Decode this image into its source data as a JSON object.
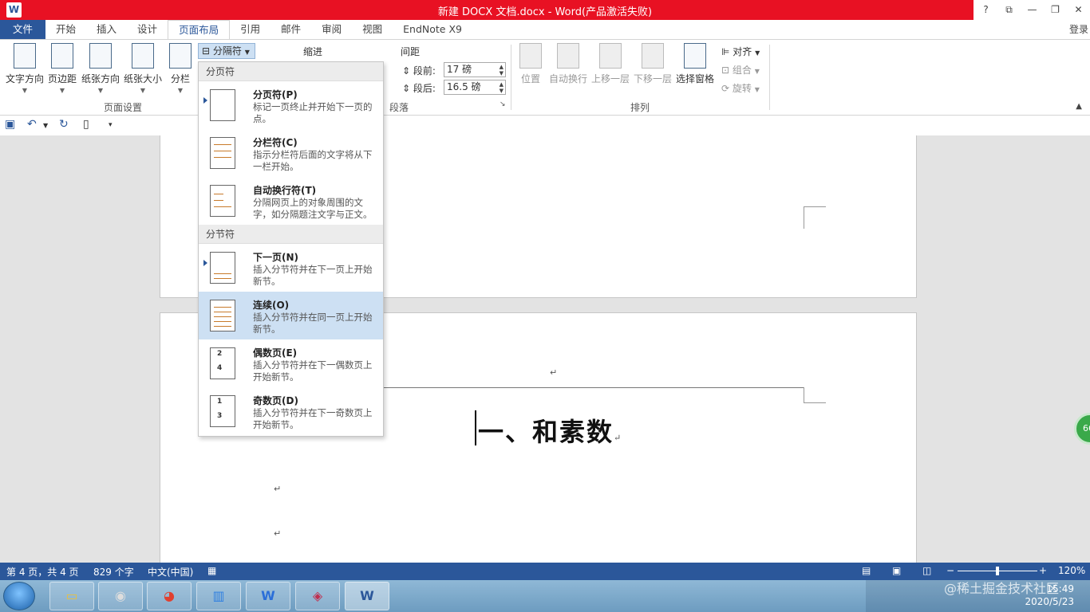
{
  "title": "新建 DOCX 文档.docx -  Word(产品激活失败)",
  "window_buttons": [
    "?",
    "⧉",
    "—",
    "❐",
    "✕"
  ],
  "tabs": [
    "文件",
    "开始",
    "插入",
    "设计",
    "页面布局",
    "引用",
    "邮件",
    "审阅",
    "视图",
    "EndNote X9"
  ],
  "login": "登录",
  "ribbon": {
    "page_setup": {
      "buttons": [
        "文字方向",
        "页边距",
        "纸张方向",
        "纸张大小",
        "分栏"
      ],
      "group_label": "页面设置",
      "breaks_button": "分隔符"
    },
    "paragraph": {
      "indent_label": "缩进",
      "spacing_label": "间距",
      "before_label": "段前:",
      "before_value": "17 磅",
      "after_label": "段后:",
      "after_value": "16.5 磅",
      "group_label": "段落"
    },
    "arrange": {
      "buttons": [
        "位置",
        "自动换行",
        "上移一层",
        "下移一层",
        "选择窗格"
      ],
      "small_buttons": [
        "对齐",
        "组合",
        "旋转"
      ],
      "group_label": "排列"
    }
  },
  "breaks_menu": {
    "page_breaks_header": "分页符",
    "page_breaks": [
      {
        "title": "分页符(P)",
        "desc": "标记一页终止并开始下一页的点。"
      },
      {
        "title": "分栏符(C)",
        "desc": "指示分栏符后面的文字将从下一栏开始。"
      },
      {
        "title": "自动换行符(T)",
        "desc": "分隔网页上的对象周围的文字，如分隔题注文字与正文。"
      }
    ],
    "section_breaks_header": "分节符",
    "section_breaks": [
      {
        "title": "下一页(N)",
        "desc": "插入分节符并在下一页上开始新节。"
      },
      {
        "title": "连续(O)",
        "desc": "插入分节符并在同一页上开始新节。"
      },
      {
        "title": "偶数页(E)",
        "desc": "插入分节符并在下一偶数页上开始新节。",
        "nums": [
          "2",
          "4"
        ]
      },
      {
        "title": "奇数页(D)",
        "desc": "插入分节符并在下一奇数页上开始新节。",
        "nums": [
          "1",
          "3"
        ]
      }
    ]
  },
  "document": {
    "heading": "一、和素数",
    "para_mark": "↵",
    "badge": "66"
  },
  "status": {
    "page": "第 4 页，共 4 页",
    "words": "829 个字",
    "lang": "中文(中国)",
    "zoom": "120%",
    "zoom_minus": "−",
    "zoom_plus": "+"
  },
  "taskbar": {
    "time": "15:49",
    "date": "2020/5/23",
    "watermark": "@稀土掘金技术社区"
  },
  "colors": {
    "accent": "#2b579a",
    "title_red": "#e81123",
    "highlight": "#cde0f3"
  }
}
